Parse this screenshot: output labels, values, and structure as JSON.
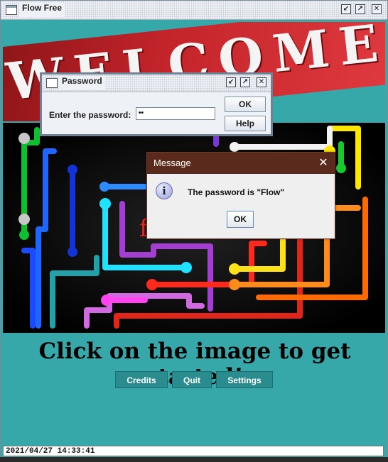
{
  "window": {
    "title": "Flow Free",
    "icon": "window-icon"
  },
  "banner": {
    "text": "WELCOME!"
  },
  "image_overlay_text": "f",
  "headline": "Click on the image to get started!",
  "buttons": {
    "credits": "Credits",
    "quit": "Quit",
    "settings": "Settings"
  },
  "status": {
    "timestamp": "2021/04/27 14:33:41"
  },
  "password_dialog": {
    "title": "Password",
    "label": "Enter the password:",
    "value": "••",
    "ok": "OK",
    "help": "Help"
  },
  "message_dialog": {
    "title": "Message",
    "text": "The password is \"Flow\"",
    "ok": "OK",
    "close": "✕",
    "info_glyph": "i"
  },
  "colors": {
    "background": "#37a8aa",
    "banner_red": "#c2242a",
    "button": "#2a8c8e",
    "message_titlebar": "#5a2a1c"
  }
}
